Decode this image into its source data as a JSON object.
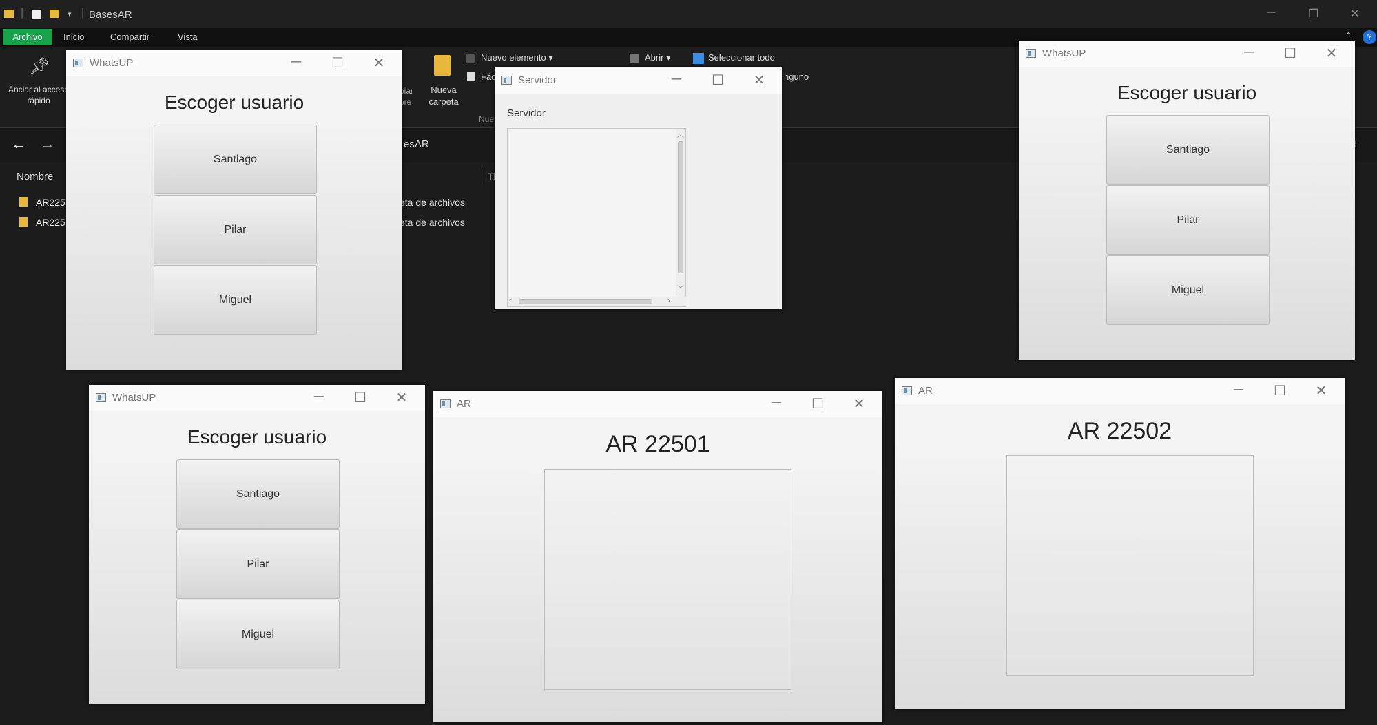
{
  "explorer": {
    "title": "BasesAR",
    "menu": [
      "Archivo",
      "Inicio",
      "Compartir",
      "Vista"
    ],
    "ribbon": {
      "pin_label": "Anclar al acceso rápido",
      "paste_partial": "piar ore",
      "new_folder": "Nueva carpeta",
      "new_item": "Nuevo elemento",
      "easy_access": "Fác",
      "new_group": "Nue",
      "open": "Abrir",
      "select_all": "Seleccionar todo",
      "select_none": "nguno"
    },
    "address": "esAR",
    "column_name": "Nombre",
    "column_type": "Ti",
    "items": [
      {
        "name": "AR225",
        "type": "eta de archivos"
      },
      {
        "name": "AR225",
        "type": "eta de archivos"
      }
    ],
    "search_partial": "R"
  },
  "windows": {
    "whatsup1": {
      "title": "WhatsUP",
      "heading": "Escoger usuario",
      "users": [
        "Santiago",
        "Pilar",
        "Miguel"
      ]
    },
    "whatsup2": {
      "title": "WhatsUP",
      "heading": "Escoger usuario",
      "users": [
        "Santiago",
        "Pilar",
        "Miguel"
      ]
    },
    "whatsup3": {
      "title": "WhatsUP",
      "heading": "Escoger usuario",
      "users": [
        "Santiago",
        "Pilar",
        "Miguel"
      ]
    },
    "servidor": {
      "title": "Servidor",
      "label": "Servidor"
    },
    "ar1": {
      "title": "AR",
      "heading": "AR 22501"
    },
    "ar2": {
      "title": "AR",
      "heading": "AR 22502"
    }
  },
  "colors": {
    "explorer_accent": "#18a34a",
    "help": "#1e6fd9"
  }
}
